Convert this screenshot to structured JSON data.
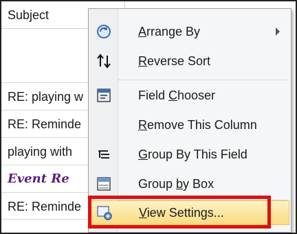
{
  "list": {
    "header": "Subject",
    "rows": [
      {
        "text": "RE: playing w",
        "style": "normal"
      },
      {
        "text": "RE: Reminde",
        "style": "normal"
      },
      {
        "text": "playing with",
        "style": "normal"
      },
      {
        "text": "Event Re",
        "style": "event"
      },
      {
        "text": "RE: Reminde",
        "style": "normal"
      }
    ]
  },
  "menu": {
    "items": [
      {
        "pre": "",
        "key": "A",
        "post": "rrange By",
        "icon": "arrange-by-icon",
        "submenu": true
      },
      {
        "pre": "",
        "key": "R",
        "post": "everse Sort",
        "icon": "reverse-sort-icon"
      },
      {
        "pre": "Field ",
        "key": "C",
        "post": "hooser",
        "icon": "field-chooser-icon"
      },
      {
        "pre": "",
        "key": "R",
        "post": "emove This Column",
        "icon": ""
      },
      {
        "pre": "",
        "key": "G",
        "post": "roup By This Field",
        "icon": "group-by-field-icon"
      },
      {
        "pre": "Group ",
        "key": "b",
        "post": "y Box",
        "icon": "group-by-box-icon"
      },
      {
        "pre": "",
        "key": "V",
        "post": "iew Settings...",
        "icon": "view-settings-icon",
        "highlighted": true
      }
    ]
  },
  "colors": {
    "highlight": "#f9dc82",
    "callout": "#e01010",
    "event_text": "#5b1f7a"
  }
}
